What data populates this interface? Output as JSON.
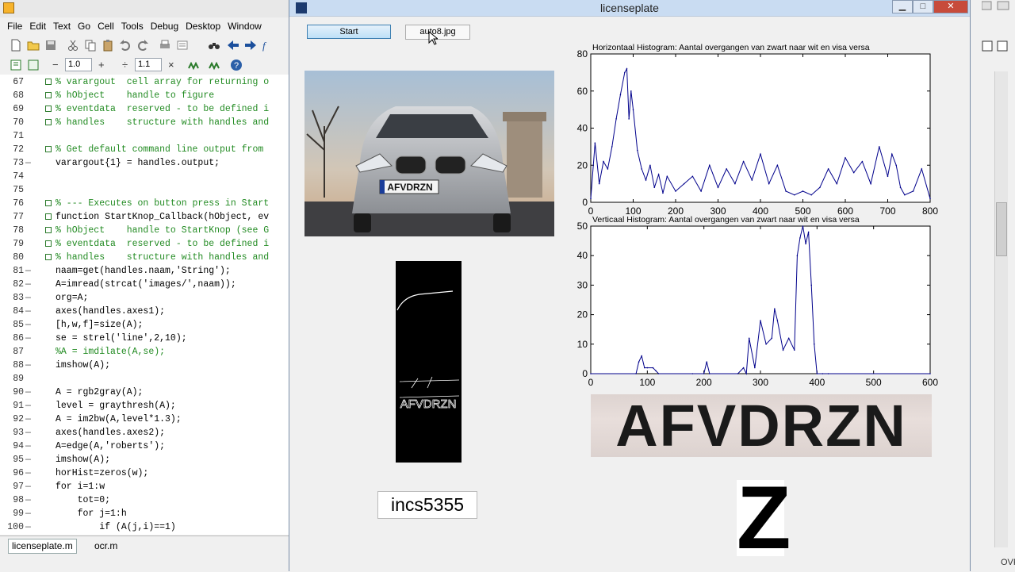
{
  "editor": {
    "menu": [
      "File",
      "Edit",
      "Text",
      "Go",
      "Cell",
      "Tools",
      "Debug",
      "Desktop",
      "Window"
    ],
    "toolbar": {
      "decrement": "−",
      "value_a": "1.0",
      "increment": "+",
      "divide": "÷",
      "value_b": "1.1"
    },
    "lines": [
      {
        "n": "67",
        "dash": "",
        "text": "% varargout  cell array for returning o",
        "comment": true
      },
      {
        "n": "68",
        "dash": "",
        "text": "% hObject    handle to figure",
        "comment": true
      },
      {
        "n": "69",
        "dash": "",
        "text": "% eventdata  reserved - to be defined i",
        "comment": true
      },
      {
        "n": "70",
        "dash": "",
        "text": "% handles    structure with handles and",
        "comment": true
      },
      {
        "n": "71",
        "dash": "",
        "text": "",
        "comment": false
      },
      {
        "n": "72",
        "dash": "",
        "text": "% Get default command line output from",
        "comment": true
      },
      {
        "n": "73",
        "dash": "—",
        "text": "varargout{1} = handles.output;",
        "comment": false
      },
      {
        "n": "74",
        "dash": "",
        "text": "",
        "comment": false
      },
      {
        "n": "75",
        "dash": "",
        "text": "",
        "comment": false
      },
      {
        "n": "76",
        "dash": "",
        "text": "% --- Executes on button press in Start",
        "comment": true
      },
      {
        "n": "77",
        "dash": "",
        "text": "function StartKnop_Callback(hObject, ev",
        "comment": false
      },
      {
        "n": "78",
        "dash": "",
        "text": "% hObject    handle to StartKnop (see G",
        "comment": true
      },
      {
        "n": "79",
        "dash": "",
        "text": "% eventdata  reserved - to be defined i",
        "comment": true
      },
      {
        "n": "80",
        "dash": "",
        "text": "% handles    structure with handles and",
        "comment": true
      },
      {
        "n": "81",
        "dash": "—",
        "text": "naam=get(handles.naam,'String');",
        "comment": false
      },
      {
        "n": "82",
        "dash": "—",
        "text": "A=imread(strcat('images/',naam));",
        "comment": false
      },
      {
        "n": "83",
        "dash": "—",
        "text": "org=A;",
        "comment": false
      },
      {
        "n": "84",
        "dash": "—",
        "text": "axes(handles.axes1);",
        "comment": false
      },
      {
        "n": "85",
        "dash": "—",
        "text": "[h,w,f]=size(A);",
        "comment": false
      },
      {
        "n": "86",
        "dash": "—",
        "text": "se = strel('line',2,10);",
        "comment": false
      },
      {
        "n": "87",
        "dash": "",
        "text": "%A = imdilate(A,se);",
        "comment": true
      },
      {
        "n": "88",
        "dash": "—",
        "text": "imshow(A);",
        "comment": false
      },
      {
        "n": "89",
        "dash": "",
        "text": "",
        "comment": false
      },
      {
        "n": "90",
        "dash": "—",
        "text": "A = rgb2gray(A);",
        "comment": false
      },
      {
        "n": "91",
        "dash": "—",
        "text": "level = graythresh(A);",
        "comment": false
      },
      {
        "n": "92",
        "dash": "—",
        "text": "A = im2bw(A,level*1.3);",
        "comment": false
      },
      {
        "n": "93",
        "dash": "—",
        "text": "axes(handles.axes2);",
        "comment": false
      },
      {
        "n": "94",
        "dash": "—",
        "text": "A=edge(A,'roberts');",
        "comment": false
      },
      {
        "n": "95",
        "dash": "—",
        "text": "imshow(A);",
        "comment": false
      },
      {
        "n": "96",
        "dash": "—",
        "text": "horHist=zeros(w);",
        "comment": false
      },
      {
        "n": "97",
        "dash": "—",
        "text": "for i=1:w",
        "comment": false
      },
      {
        "n": "98",
        "dash": "—",
        "text": "    tot=0;",
        "comment": false
      },
      {
        "n": "99",
        "dash": "—",
        "text": "    for j=1:h",
        "comment": false
      },
      {
        "n": "100",
        "dash": "—",
        "text": "        if (A(j,i)==1)",
        "comment": false
      }
    ],
    "tabs": [
      "licenseplate.m",
      "ocr.m"
    ]
  },
  "status": {
    "ovr": "OVR"
  },
  "figure": {
    "title": "licenseplate",
    "start_label": "Start",
    "file_value": "auto8.jpg",
    "plate_zoom_text": "AFVDRZN",
    "car_plate_text": "AFVDRZN",
    "edge_plate_text": "AFVDRZN",
    "result_text": "incs5355",
    "char": "Z"
  },
  "colors": {
    "accent": "#00008b",
    "comment": "#228b22",
    "title_bar": "#c9dcf2",
    "close": "#c74b3b"
  },
  "chart_data": [
    {
      "type": "line",
      "title": "Horizontaal Histogram: Aantal overgangen van zwart naar wit en visa versa",
      "xlabel": "",
      "ylabel": "",
      "xlim": [
        0,
        800
      ],
      "ylim": [
        0,
        80
      ],
      "xticks": [
        0,
        100,
        200,
        300,
        400,
        500,
        600,
        700,
        800
      ],
      "yticks": [
        0,
        20,
        40,
        60,
        80
      ],
      "x": [
        0,
        10,
        20,
        30,
        40,
        50,
        60,
        70,
        80,
        85,
        90,
        95,
        100,
        110,
        120,
        130,
        140,
        150,
        160,
        170,
        180,
        200,
        220,
        240,
        260,
        280,
        300,
        320,
        340,
        360,
        380,
        400,
        420,
        440,
        460,
        480,
        500,
        520,
        540,
        560,
        580,
        600,
        620,
        640,
        660,
        680,
        700,
        710,
        720,
        730,
        740,
        760,
        780,
        800
      ],
      "values": [
        2,
        32,
        10,
        22,
        18,
        30,
        45,
        58,
        70,
        72,
        45,
        60,
        50,
        28,
        18,
        12,
        20,
        8,
        15,
        5,
        14,
        6,
        10,
        14,
        6,
        20,
        8,
        18,
        10,
        22,
        12,
        26,
        10,
        20,
        6,
        4,
        6,
        4,
        8,
        18,
        10,
        24,
        16,
        22,
        10,
        30,
        14,
        26,
        20,
        8,
        4,
        6,
        18,
        2
      ]
    },
    {
      "type": "line",
      "title": "Verticaal Histogram: Aantal overgangen van zwart naar wit en visa versa",
      "xlabel": "",
      "ylabel": "",
      "xlim": [
        0,
        600
      ],
      "ylim": [
        0,
        50
      ],
      "xticks": [
        0,
        100,
        200,
        300,
        400,
        500,
        600
      ],
      "yticks": [
        0,
        10,
        20,
        30,
        40,
        50
      ],
      "x": [
        0,
        80,
        85,
        90,
        95,
        100,
        110,
        115,
        120,
        180,
        200,
        205,
        210,
        260,
        270,
        275,
        280,
        290,
        300,
        310,
        320,
        325,
        330,
        340,
        350,
        360,
        365,
        370,
        375,
        380,
        385,
        390,
        395,
        400,
        410,
        420,
        600
      ],
      "values": [
        0,
        0,
        4,
        6,
        2,
        2,
        2,
        1,
        0,
        0,
        0,
        4,
        0,
        0,
        2,
        0,
        12,
        2,
        18,
        10,
        12,
        22,
        18,
        8,
        12,
        8,
        40,
        46,
        50,
        44,
        48,
        30,
        10,
        0,
        0,
        0,
        0
      ]
    }
  ]
}
